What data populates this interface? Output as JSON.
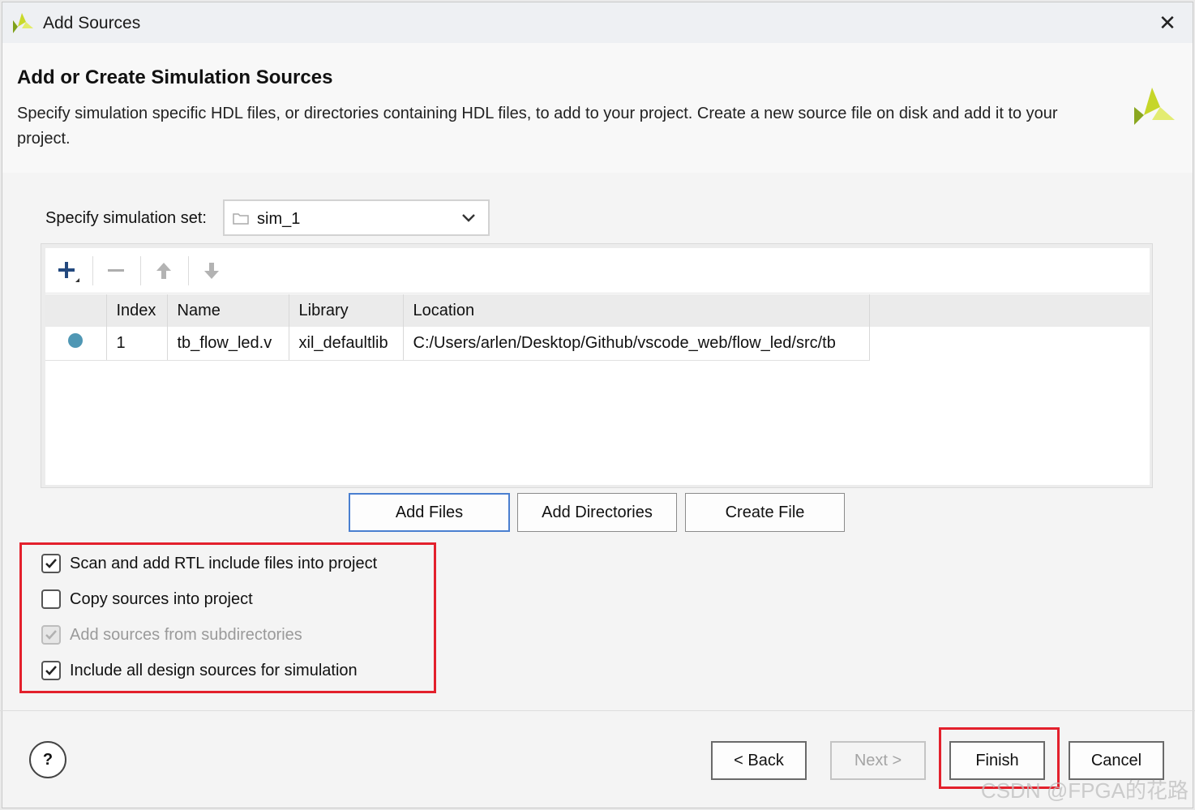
{
  "window": {
    "title": "Add Sources",
    "close_glyph": "✕"
  },
  "header": {
    "title": "Add or Create Simulation Sources",
    "description": "Specify simulation specific HDL files, or directories containing HDL files, to add to your project. Create a new source file on disk and add it to your project."
  },
  "simulation_set": {
    "label": "Specify simulation set:",
    "value": "sim_1"
  },
  "toolbar": {
    "icons": [
      "add-icon",
      "remove-icon",
      "move-up-icon",
      "move-down-icon"
    ]
  },
  "table": {
    "columns": [
      "",
      "Index",
      "Name",
      "Library",
      "Location"
    ],
    "rows": [
      {
        "index": "1",
        "name": "tb_flow_led.v",
        "library": "xil_defaultlib",
        "location": "C:/Users/arlen/Desktop/Github/vscode_web/flow_led/src/tb"
      }
    ]
  },
  "action_buttons": {
    "add_files": "Add Files",
    "add_directories": "Add Directories",
    "create_file": "Create File"
  },
  "options": [
    {
      "label": "Scan and add RTL include files into project",
      "checked": true,
      "enabled": true
    },
    {
      "label": "Copy sources into project",
      "checked": false,
      "enabled": true
    },
    {
      "label": "Add sources from subdirectories",
      "checked": true,
      "enabled": false
    },
    {
      "label": "Include all design sources for simulation",
      "checked": true,
      "enabled": true
    }
  ],
  "footer": {
    "help": "?",
    "back": "< Back",
    "next": "Next >",
    "finish": "Finish",
    "cancel": "Cancel"
  },
  "watermark": "CSDN @FPGA的花路",
  "colors": {
    "status_dot": "#4f97b4",
    "highlight": "#e3202c",
    "focus": "#4a7fd0"
  }
}
